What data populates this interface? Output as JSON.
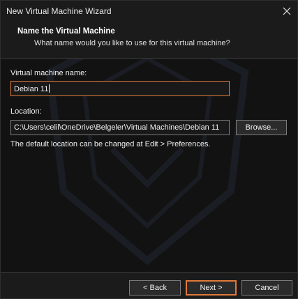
{
  "window": {
    "title": "New Virtual Machine Wizard"
  },
  "header": {
    "title": "Name the Virtual Machine",
    "subtitle": "What name would you like to use for this virtual machine?"
  },
  "form": {
    "name_label": "Virtual machine name:",
    "name_value": "Debian 11",
    "location_label": "Location:",
    "location_value": "C:\\Users\\celil\\OneDrive\\Belgeler\\Virtual Machines\\Debian 11",
    "browse_label": "Browse...",
    "hint": "The default location can be changed at Edit > Preferences."
  },
  "footer": {
    "back_label": "< Back",
    "next_label": "Next >",
    "cancel_label": "Cancel"
  },
  "colors": {
    "accent": "#e07a3a",
    "background": "#121212",
    "chrome": "#1b1b1b"
  },
  "icons": {
    "close": "close-icon",
    "watermark": "shield-watermark-icon"
  }
}
